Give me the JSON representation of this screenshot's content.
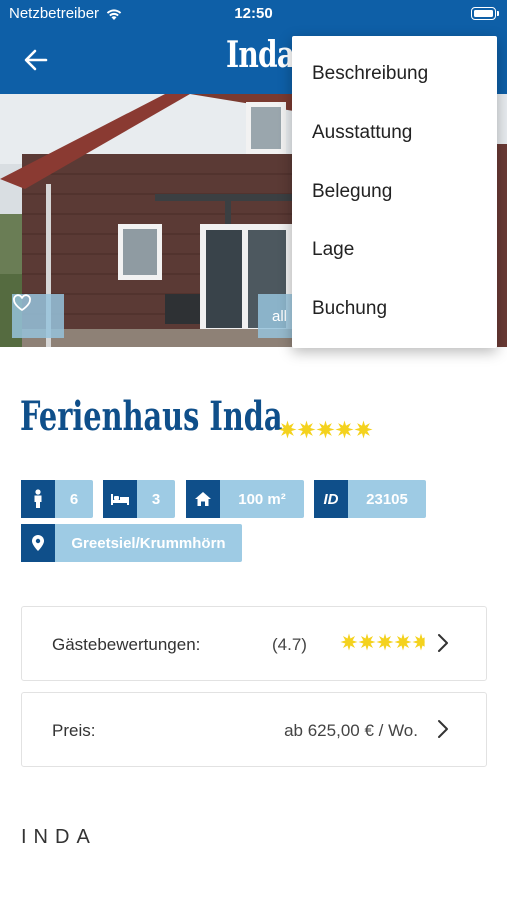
{
  "status": {
    "carrier": "Netzbetreiber",
    "time": "12:50"
  },
  "nav": {
    "title": "Inda"
  },
  "hero": {
    "all_button_label": "all"
  },
  "menu": {
    "items": [
      {
        "label": "Beschreibung"
      },
      {
        "label": "Ausstattung"
      },
      {
        "label": "Belegung"
      },
      {
        "label": "Lage"
      },
      {
        "label": "Buchung"
      }
    ]
  },
  "property": {
    "title": "Ferienhaus Inda",
    "title_stars": 5
  },
  "chips": {
    "persons": "6",
    "bedrooms": "3",
    "area": "100 m²",
    "id_label": "ID",
    "id_value": "23105",
    "location": "Greetsiel/Krummhörn"
  },
  "reviews": {
    "label": "Gästebewertungen:",
    "score": "(4.7)",
    "rating": 4.7
  },
  "price": {
    "label": "Preis:",
    "value": "ab 625,00 € / Wo."
  },
  "footer": {
    "brand": "INDA"
  },
  "colors": {
    "brand_blue": "#0e5fa7",
    "dark_blue": "#0f4f8a",
    "chip_light": "#9ecbe4",
    "star_yellow": "#f4d21e"
  }
}
